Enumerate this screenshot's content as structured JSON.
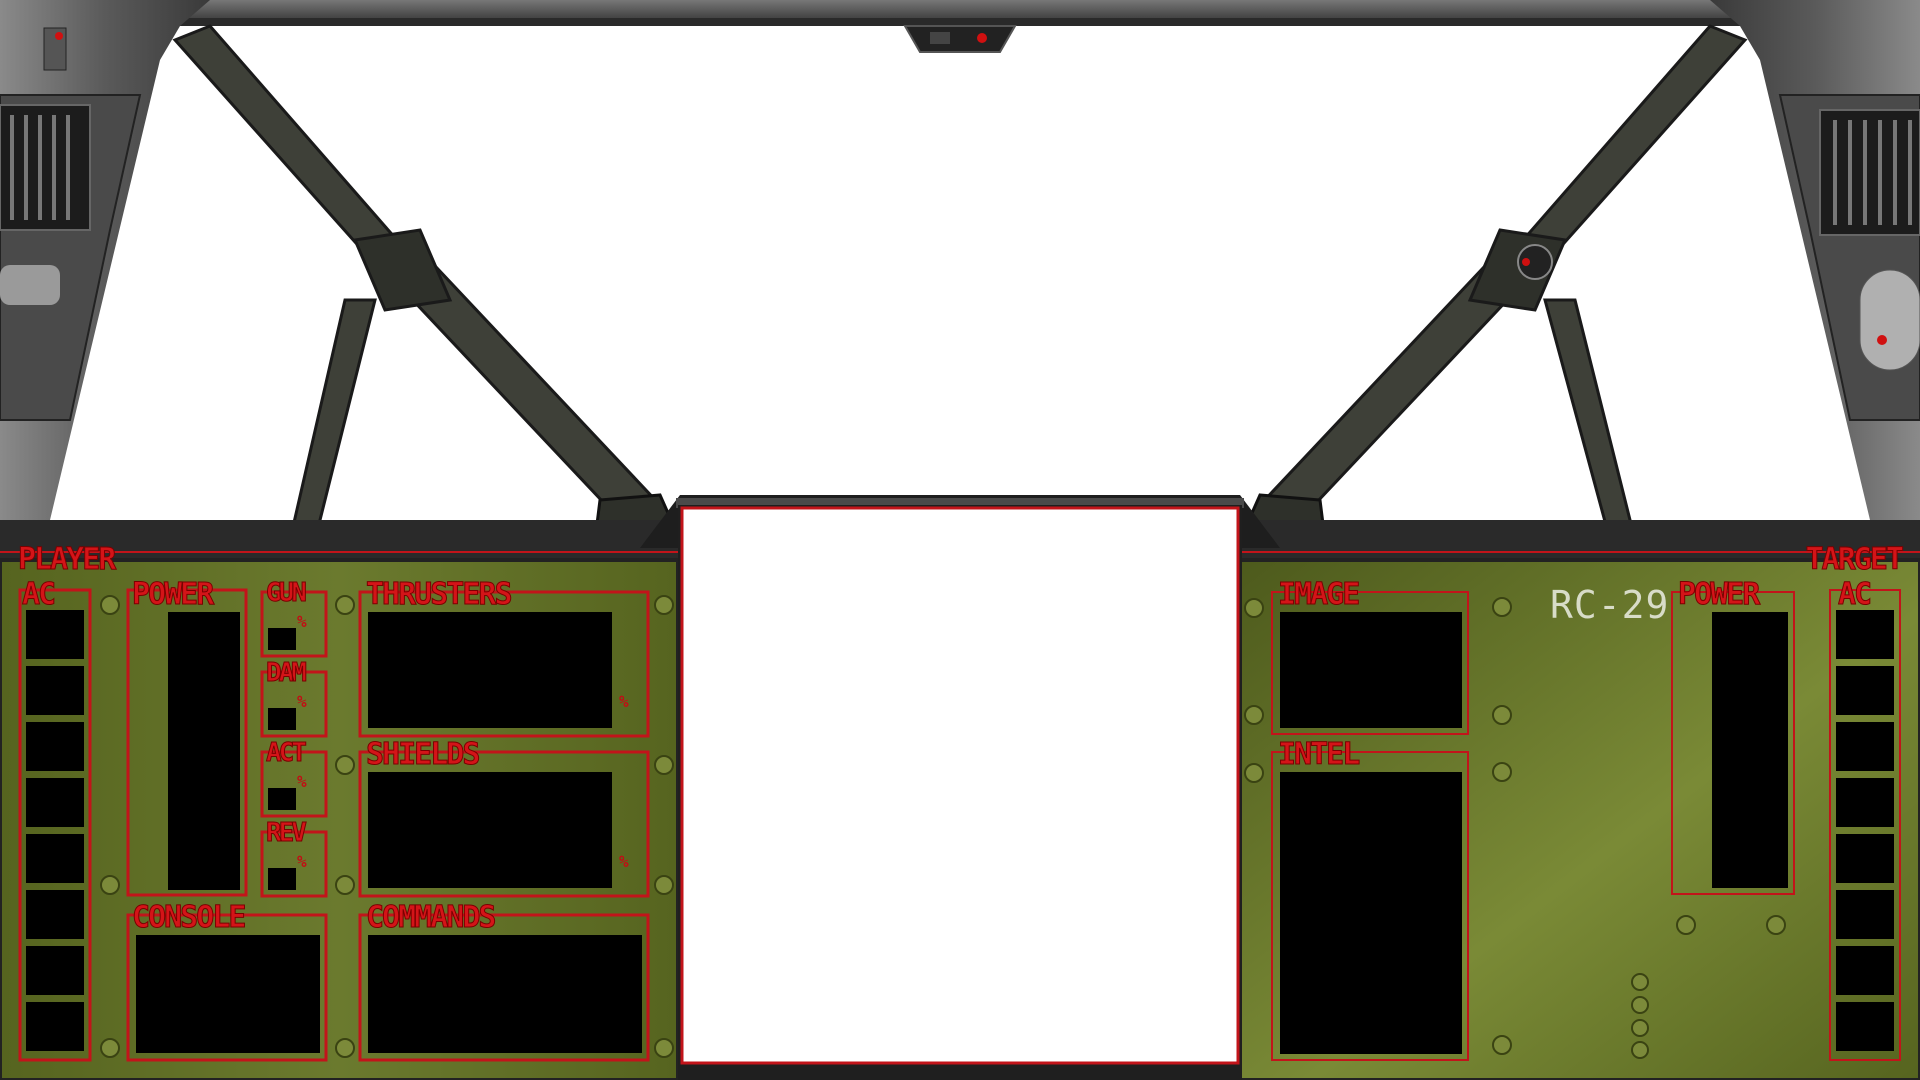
{
  "player": {
    "label": "PLAYER",
    "ac_label": "AC"
  },
  "target": {
    "label": "TARGET",
    "ac_label": "AC"
  },
  "panels": {
    "power": "POWER",
    "gun": "GUN",
    "dam": "DAM",
    "act": "ACT",
    "rev": "REV",
    "thrusters": "THRUSTERS",
    "shields": "SHIELDS",
    "console": "CONSOLE",
    "commands": "COMMANDS",
    "image": "IMAGE",
    "intel": "INTEL",
    "target_power": "POWER"
  },
  "percent_symbol": "%",
  "ship_model": "RC-29",
  "colors": {
    "panel_olive": "#5b6a23",
    "frame_red": "#c2141a",
    "screen": "#000000",
    "hull_gray": "#3a3a3a"
  }
}
